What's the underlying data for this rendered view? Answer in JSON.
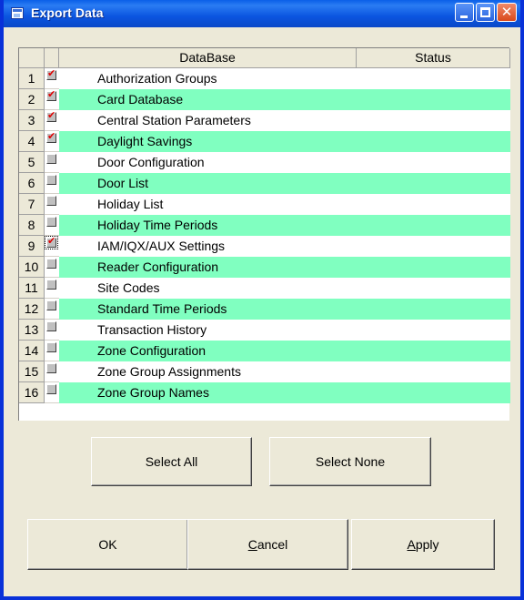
{
  "window": {
    "title": "Export Data"
  },
  "titlebar": {
    "icon": "app-window-icon",
    "min_icon": "minimize-icon",
    "max_icon": "maximize-icon",
    "close_icon": "close-icon",
    "close_glyph": "✕"
  },
  "table": {
    "headers": {
      "database": "DataBase",
      "status": "Status"
    },
    "rows": [
      {
        "num": "1",
        "name": "Authorization Groups",
        "checked": true,
        "status": ""
      },
      {
        "num": "2",
        "name": "Card Database",
        "checked": true,
        "status": ""
      },
      {
        "num": "3",
        "name": "Central Station Parameters",
        "checked": true,
        "status": ""
      },
      {
        "num": "4",
        "name": "Daylight Savings",
        "checked": true,
        "status": ""
      },
      {
        "num": "5",
        "name": "Door Configuration",
        "checked": false,
        "status": ""
      },
      {
        "num": "6",
        "name": "Door List",
        "checked": false,
        "status": ""
      },
      {
        "num": "7",
        "name": "Holiday List",
        "checked": false,
        "status": ""
      },
      {
        "num": "8",
        "name": "Holiday Time Periods",
        "checked": false,
        "status": ""
      },
      {
        "num": "9",
        "name": "IAM/IQX/AUX Settings",
        "checked": true,
        "status": ""
      },
      {
        "num": "10",
        "name": "Reader Configuration",
        "checked": false,
        "status": ""
      },
      {
        "num": "11",
        "name": "Site Codes",
        "checked": false,
        "status": ""
      },
      {
        "num": "12",
        "name": "Standard Time Periods",
        "checked": false,
        "status": ""
      },
      {
        "num": "13",
        "name": "Transaction History",
        "checked": false,
        "status": ""
      },
      {
        "num": "14",
        "name": "Zone Configuration",
        "checked": false,
        "status": ""
      },
      {
        "num": "15",
        "name": "Zone Group Assignments",
        "checked": false,
        "status": ""
      },
      {
        "num": "16",
        "name": "Zone Group Names",
        "checked": false,
        "status": ""
      }
    ]
  },
  "buttons": {
    "select_all": "Select All",
    "select_none": "Select None",
    "ok": "OK",
    "cancel_mnemonic": "C",
    "cancel_rest": "ancel",
    "apply_mnemonic": "A",
    "apply_rest": "pply"
  },
  "colors": {
    "alt_row": "#80ffc0",
    "check": "#e00000",
    "title_bar": "#0a5fe8"
  }
}
